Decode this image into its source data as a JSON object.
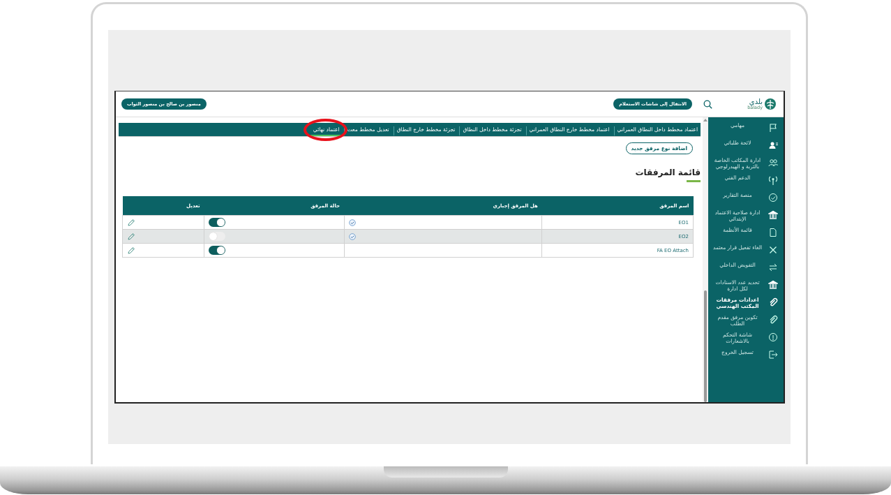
{
  "header": {
    "user_button": "منصور بن صالح بن منصور الثواب",
    "goto_button": "الانتقال إلى شاشات الاستعلام",
    "logo_text": "بلدي",
    "logo_subtext": "balady"
  },
  "tabs": [
    {
      "label": "اعتماد مخطط داخل النطاق العمراني",
      "selected": false
    },
    {
      "label": "اعتماد مخطط خارج النطاق العمراني",
      "selected": false
    },
    {
      "label": "تجزئة مخطط داخل النطاق",
      "selected": false
    },
    {
      "label": "تجزئة مخطط خارج النطاق",
      "selected": false
    },
    {
      "label": "تعديل مخطط معت",
      "selected": false
    },
    {
      "label": "اعتماد نهائي",
      "selected": true
    }
  ],
  "add_button": "اضافة نوع مرفق جديد",
  "page_title": "قائمة المرفقات",
  "table": {
    "columns": [
      "اسم المرفق",
      "هل المرفق إجباري",
      "حالة المرفق",
      "تعديل"
    ],
    "rows": [
      {
        "name": "EO1",
        "mandatory": true,
        "active": true,
        "selected": false
      },
      {
        "name": "EO2",
        "mandatory": true,
        "active": false,
        "selected": true
      },
      {
        "name": "FA EO Attach",
        "mandatory": false,
        "active": true,
        "selected": false
      }
    ]
  },
  "sidebar": {
    "items": [
      {
        "label": "مهامي",
        "selected": false
      },
      {
        "label": "لائحة طلباتي",
        "selected": false
      },
      {
        "label": "ادارة المكاتب الخاصة بالتربة و الهيدرلوجي",
        "selected": false
      },
      {
        "label": "الدعم الفني",
        "selected": false
      },
      {
        "label": "منصة التقارير",
        "selected": false
      },
      {
        "label": "ادارة صلاحية الاعتماد الإبتدائي",
        "selected": false
      },
      {
        "label": "قائمة الأنظمة",
        "selected": false
      },
      {
        "label": "الغاء تفعيل قرار معتمد",
        "selected": false
      },
      {
        "label": "التفويض الداخلي",
        "selected": false
      },
      {
        "label": "تحديد عدد الاسنادات لكل ادارة",
        "selected": false
      },
      {
        "label": "اعدادات مرفقات المكتب الهندسي",
        "selected": true
      },
      {
        "label": "تكوين مرفق مقدم الطلب",
        "selected": false
      },
      {
        "label": "شاشة التحكم بالاشعارات",
        "selected": false
      },
      {
        "label": "تسجيل الخروج",
        "selected": false
      }
    ]
  }
}
